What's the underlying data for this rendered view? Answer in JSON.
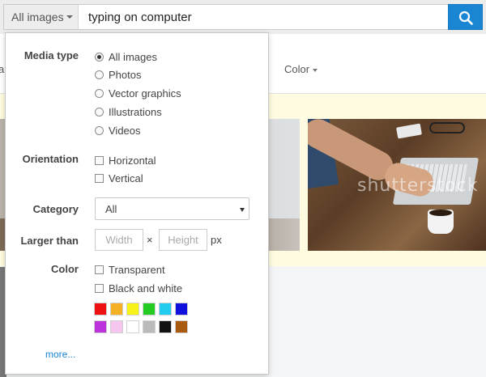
{
  "search": {
    "type_dropdown": "All images",
    "query": "typing on computer"
  },
  "filters_bar": {
    "color_label": "Color",
    "left_edge_text": "a"
  },
  "results": {
    "watermark": "shutterstock"
  },
  "panel": {
    "media_type": {
      "label": "Media type",
      "options": [
        "All images",
        "Photos",
        "Vector graphics",
        "Illustrations",
        "Videos"
      ],
      "selected": "All images"
    },
    "orientation": {
      "label": "Orientation",
      "options": [
        "Horizontal",
        "Vertical"
      ]
    },
    "category": {
      "label": "Category",
      "value": "All"
    },
    "larger_than": {
      "label": "Larger than",
      "width_placeholder": "Width",
      "height_placeholder": "Height",
      "times": "×",
      "unit": "px"
    },
    "color": {
      "label": "Color",
      "options": [
        "Transparent",
        "Black and white"
      ],
      "swatches": [
        "#ee1111",
        "#f6b023",
        "#f6f21a",
        "#22cc22",
        "#22ccee",
        "#1111dd",
        "#bb33dd",
        "#f6c6ee",
        "#ffffff",
        "#bbbbbb",
        "#111111",
        "#a85a10"
      ]
    },
    "more_link": "more..."
  },
  "colors": {
    "accent": "#1a86d3"
  }
}
